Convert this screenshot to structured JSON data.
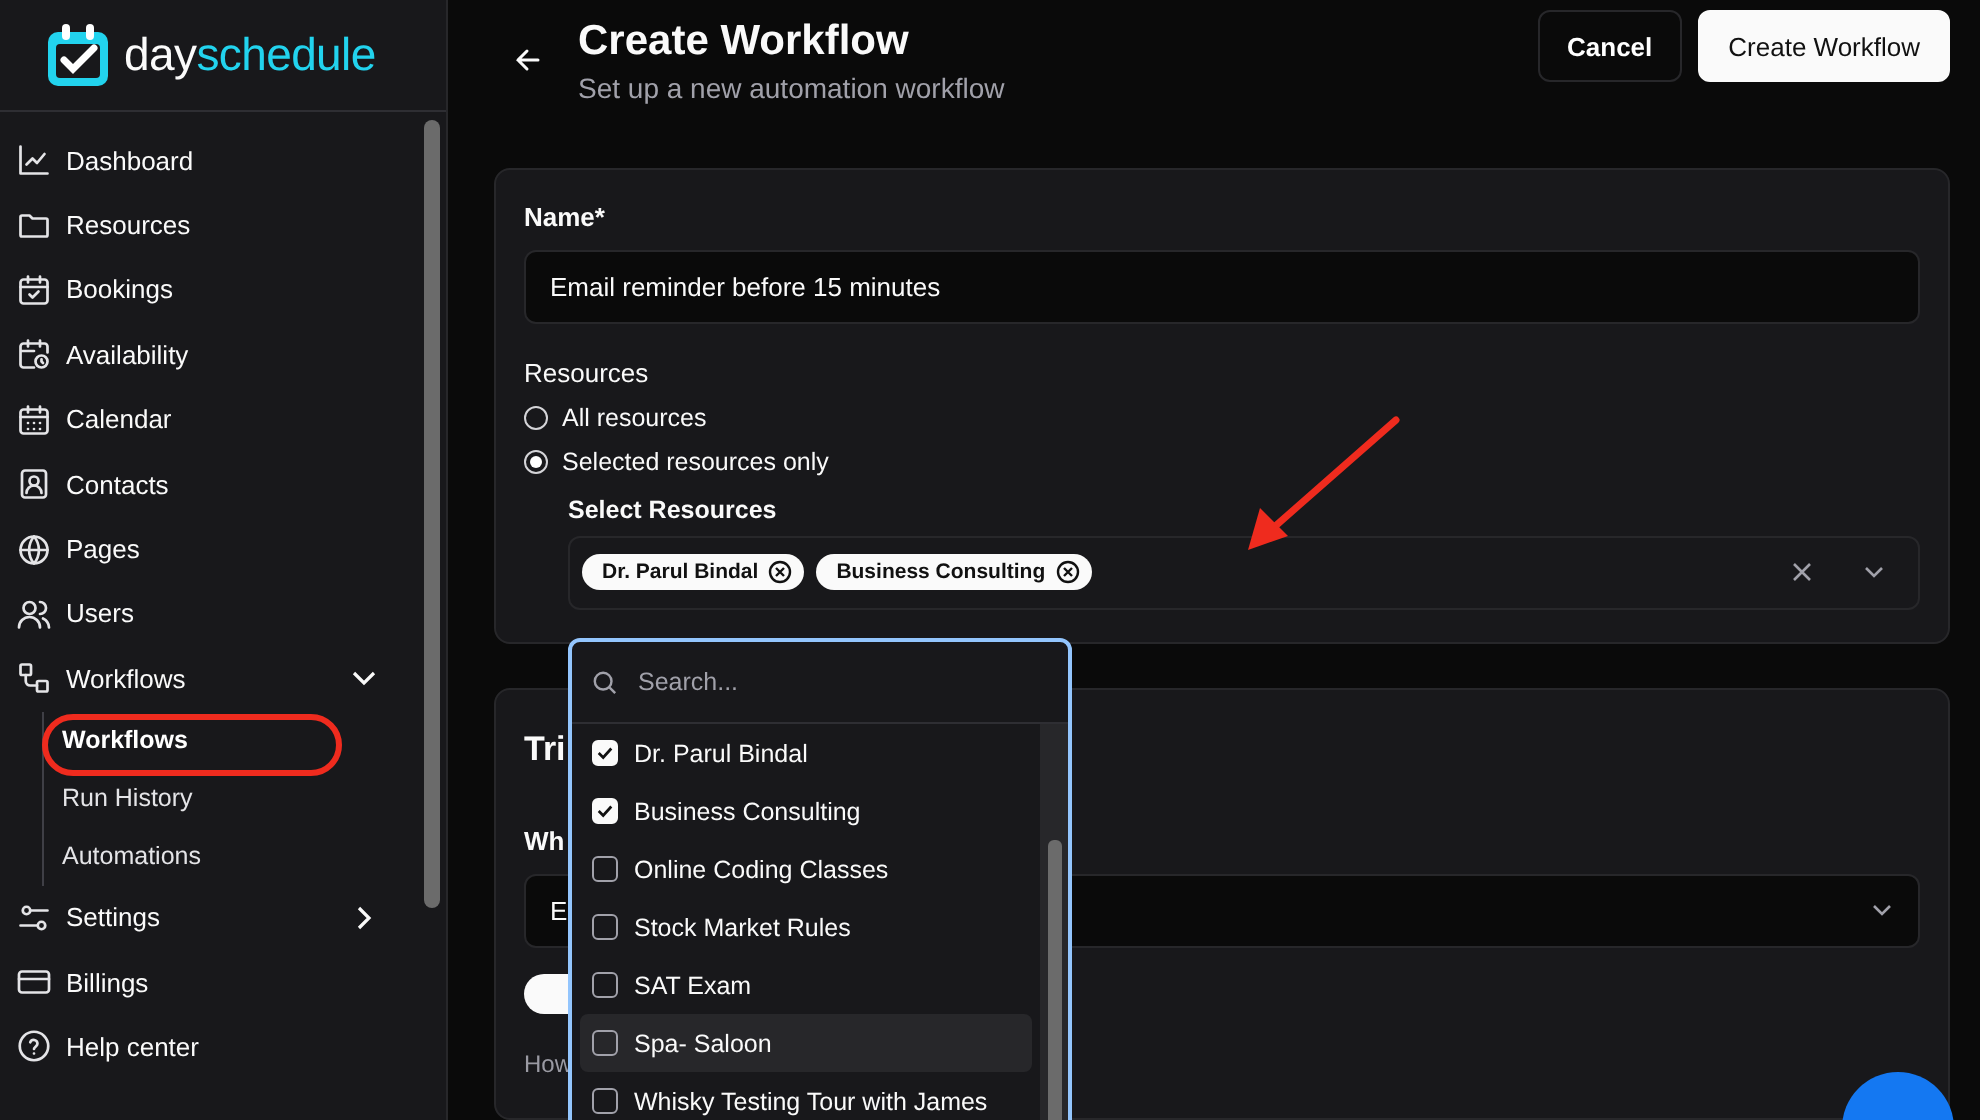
{
  "logo": {
    "part1": "day",
    "part2": "schedule"
  },
  "sidebar": {
    "items": [
      {
        "label": "Dashboard"
      },
      {
        "label": "Resources"
      },
      {
        "label": "Bookings"
      },
      {
        "label": "Availability"
      },
      {
        "label": "Calendar"
      },
      {
        "label": "Contacts"
      },
      {
        "label": "Pages"
      },
      {
        "label": "Users"
      },
      {
        "label": "Workflows",
        "expanded": true,
        "children": [
          {
            "label": "Workflows",
            "selected": true
          },
          {
            "label": "Run History",
            "selected": false
          },
          {
            "label": "Automations",
            "selected": false
          }
        ]
      },
      {
        "label": "Settings",
        "expanded": false
      },
      {
        "label": "Billings"
      },
      {
        "label": "Help center"
      }
    ]
  },
  "header": {
    "title": "Create Workflow",
    "subtitle": "Set up a new automation workflow",
    "buttons": [
      {
        "label": "Cancel",
        "kind": "secondary"
      },
      {
        "label": "Create Workflow",
        "kind": "primary"
      }
    ]
  },
  "form": {
    "name_label": "Name*",
    "name_value": "Email reminder before 15 minutes",
    "resources_label": "Resources",
    "radios": [
      {
        "label": "All resources",
        "selected": false
      },
      {
        "label": "Selected resources only",
        "selected": true
      }
    ],
    "select_label": "Select Resources",
    "chips": [
      {
        "label": "Dr. Parul Bindal"
      },
      {
        "label": "Business Consulting"
      }
    ]
  },
  "dropdown": {
    "placeholder": "Search...",
    "options": [
      {
        "label": "Dr. Parul Bindal",
        "checked": true,
        "highlighted": false
      },
      {
        "label": "Business Consulting",
        "checked": true,
        "highlighted": false
      },
      {
        "label": "Online Coding Classes",
        "checked": false,
        "highlighted": false
      },
      {
        "label": "Stock Market Rules",
        "checked": false,
        "highlighted": false
      },
      {
        "label": "SAT Exam",
        "checked": false,
        "highlighted": false
      },
      {
        "label": "Spa- Saloon",
        "checked": false,
        "highlighted": true
      },
      {
        "label": "Whisky Testing Tour with James",
        "checked": false,
        "highlighted": false
      }
    ]
  },
  "trigger": {
    "title": "Tri",
    "label": "Wh",
    "select_value": "E",
    "toggle_on": true,
    "hint": "How"
  }
}
